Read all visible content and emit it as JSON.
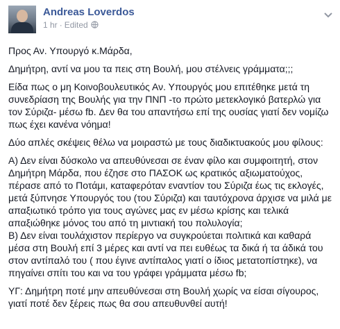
{
  "post": {
    "author": "Andreas Loverdos",
    "time": "1 hr",
    "edited": "Edited",
    "paragraphs": [
      "Προς Αν. Υπουργό κ.Μάρδα,",
      "Δημήτρη, αντί να μου τα πεις στη Βουλή, μου στέλνεις γράμματα;;;",
      "Είδα πως ο μη Κοινοβουλευτικός Αν. Υπουργός μου επιτέθηκε μετά τη συνεδρίαση της Βουλής για την ΠΝΠ -το πρώτο μετεκλογικό βατερλώ για τον Σύριζα- μέσω fb. Δεν θα του απαντήσω επί της ουσίας γιατί δεν νομίζω πως έχει κανένα νόημα!",
      "Δύο απλές σκέψεις θέλω να μοιραστώ με τους διαδικτυακούς μου φίλους:",
      "Α) Δεν είναι δύσκολο να απευθύνεσαι σε έναν φίλο και συμφοιτητή, στον Δημήτρη Μάρδα, που έζησε στο ΠΑΣΟΚ ως κρατικός αξιωματούχος, πέρασε από το Ποτάμι, καταφερόταν εναντίον του Σύριζα έως τις εκλογές, μετά ξύπνησε Υπουργός του (του Σύριζα) και ταυτόχρονα άρχισε να μιλά με απαξιωτικό τρόπο για τους αγώνες μας εν μέσω κρίσης και τελικά απαξιώθηκε μόνος του από τη μιντιακή του πολυλογία;",
      "Β) Δεν είναι τουλάχιστον περίεργο να συγκρούεται πολιτικά και καθαρά μέσα στη Βουλή επί 3 μέρες και αντί να πει ευθέως τα δικά ή τα άδικά του στον αντίπαλό του ( που έγινε αντίπαλος γιατί ο ίδιος μετατοπίστηκε), να πηγαίνει σπίτι του και να του γράφει γράμματα μέσω fb;",
      "ΥΓ: Δημήτρη ποτέ μην απευθύνεσαι στη Βουλή χωρίς να είσαι σίγουρος, γιατί ποτέ δεν ξέρεις πως θα σου απευθυνθεί αυτή!"
    ]
  }
}
